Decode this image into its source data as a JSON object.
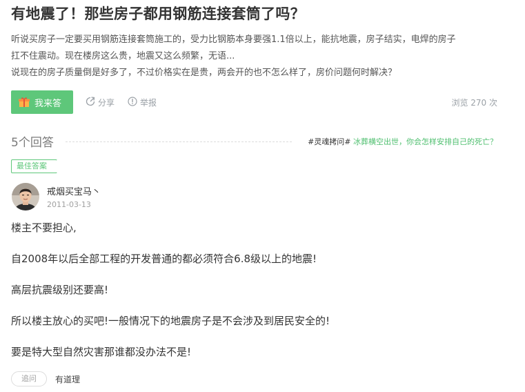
{
  "question": {
    "title": "有地震了！那些房子都用钢筋连接套筒了吗？",
    "description_lines": [
      "听说买房子一定要买用钢筋连接套筒施工的，受力比钢筋本身要强1.1倍以上，能抗地震，房子结实，电焊的房子",
      "扛不住震动。现在楼房这么贵，地震又这么频繁，无语...",
      "说现在的房子质量倒是好多了，不过价格实在是贵，两会开的也不怎么样了，房价问题何时解决？"
    ]
  },
  "actions": {
    "answer_label": "我来答",
    "share_label": "分享",
    "report_label": "举报",
    "views": "浏览 270 次"
  },
  "answers_header": {
    "count": "5个回答",
    "promo_tag": "#灵魂拷问#",
    "promo_link": "冰葬横空出世，你会怎样安排自己的死亡？"
  },
  "best_answer": {
    "badge": "最佳答案",
    "user": "戒烟买宝马丶",
    "date": "2011-03-13",
    "paragraphs": [
      "楼主不要担心,",
      "自2008年以后全部工程的开发普通的都必须符合6.8级以上的地震!",
      "高层抗震级别还要高!",
      "所以楼主放心的买吧!一般情况下的地震房子是不会涉及到居民安全的!",
      "要是特大型自然灾害那谁都没办法不是!"
    ],
    "followup_label": "追问",
    "useful_label": "有道理"
  },
  "colors": {
    "accent": "#5ec77a",
    "muted": "#9aa0a6"
  },
  "icons": {
    "answer": "gift-icon",
    "share": "share-icon",
    "report": "report-icon"
  }
}
